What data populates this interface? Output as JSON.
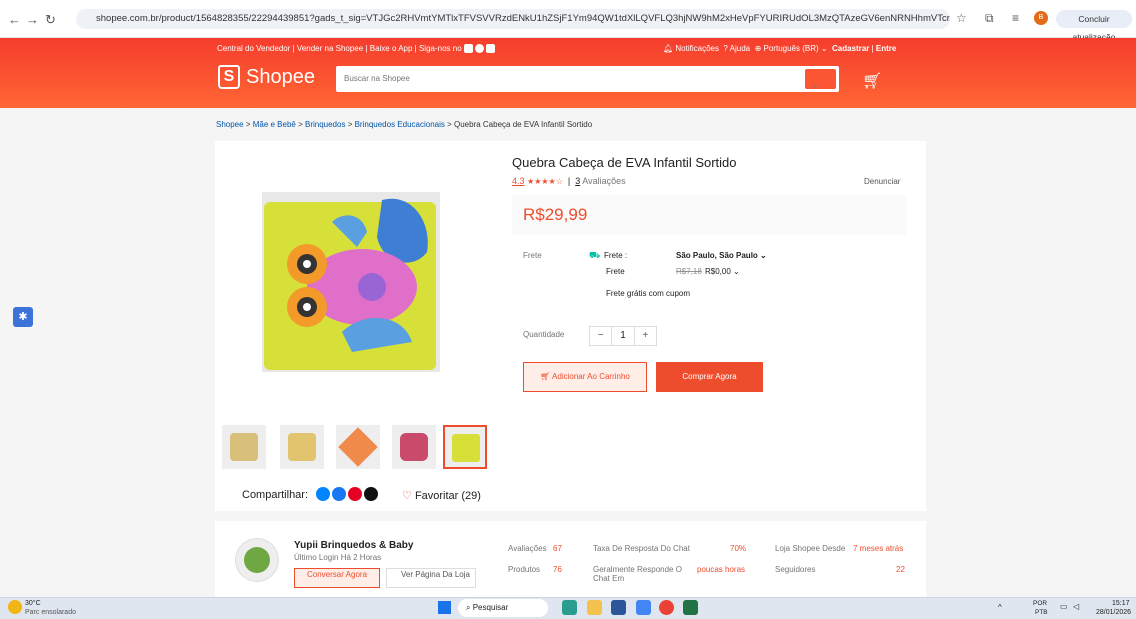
{
  "browser": {
    "url": "shopee.com.br/product/1564828355/22294439851?gads_t_sig=VTJGc2RHVmtYMTlxTFVSVVRzdENkU1hZSjF1Ym94QW1tdXlLQVFLQ3hjNW9hM2xHeVpFYURIRUdOL3MzQTAzeGV6enNRNHhmVTcrTjRQVHJEUGVPQU9vMUZXMk5uO...",
    "update_label": "Concluir atualização",
    "avatar_letter": "B"
  },
  "header": {
    "topnav_left": [
      "Central do Vendedor",
      "Vender na Shopee",
      "Baixe o App",
      "Siga-nos no"
    ],
    "notifications": "Notificações",
    "help": "Ajuda",
    "language": "Português (BR)",
    "signup": "Cadastrar",
    "login": "Entre",
    "logo_text": "Shopee",
    "logo_mark": "S",
    "search_placeholder": "Buscar na Shopee"
  },
  "breadcrumb": [
    "Shopee",
    "Mãe e Bebê",
    "Brinquedos",
    "Brinquedos Educacionais",
    "Quebra Cabeça de EVA Infantil Sortido"
  ],
  "product": {
    "title": "Quebra Cabeça de EVA Infantil Sortido",
    "rating": "4.3",
    "stars": 4.3,
    "reviews_count": "3",
    "reviews_label": "Avaliações",
    "report": "Denunciar",
    "price": "R$29,99",
    "shipping_label": "Frete",
    "shipping_sub1": "Frete :",
    "shipping_dest": "São Paulo, São Paulo",
    "shipping_sub2": "Frete",
    "shipping_old": "R$7,18",
    "shipping_new": "R$0,00",
    "free_shipping": "Frete grátis com cupom",
    "qty_label": "Quantidade",
    "qty_value": "1",
    "add_to_cart": "Adicionar Ao Carrinho",
    "buy_now": "Comprar Agora",
    "share_label": "Compartilhar:",
    "favorite": "Favoritar (29)"
  },
  "shop": {
    "name": "Yupii Brinquedos & Baby",
    "last_login": "Último Login Há 2 Horas",
    "chat_btn": "Conversar Agora",
    "view_btn": "Ver Página Da Loja",
    "stats": [
      {
        "label": "Avaliações",
        "value": "67"
      },
      {
        "label": "Produtos",
        "value": "76"
      },
      {
        "label": "Taxa De Resposta Do Chat",
        "value": "70%"
      },
      {
        "label": "Geralmente Responde O Chat Em",
        "value": "poucas horas"
      },
      {
        "label": "Loja Shopee Desde",
        "value": "7 meses atrás"
      },
      {
        "label": "Seguidores",
        "value": "22"
      }
    ]
  },
  "taskbar": {
    "weather_temp": "30°C",
    "weather_desc": "Parc ensolarado",
    "search": "Pesquisar",
    "lang": "POR",
    "lang2": "PTB",
    "time": "15:17",
    "date": "28/01/2026"
  }
}
